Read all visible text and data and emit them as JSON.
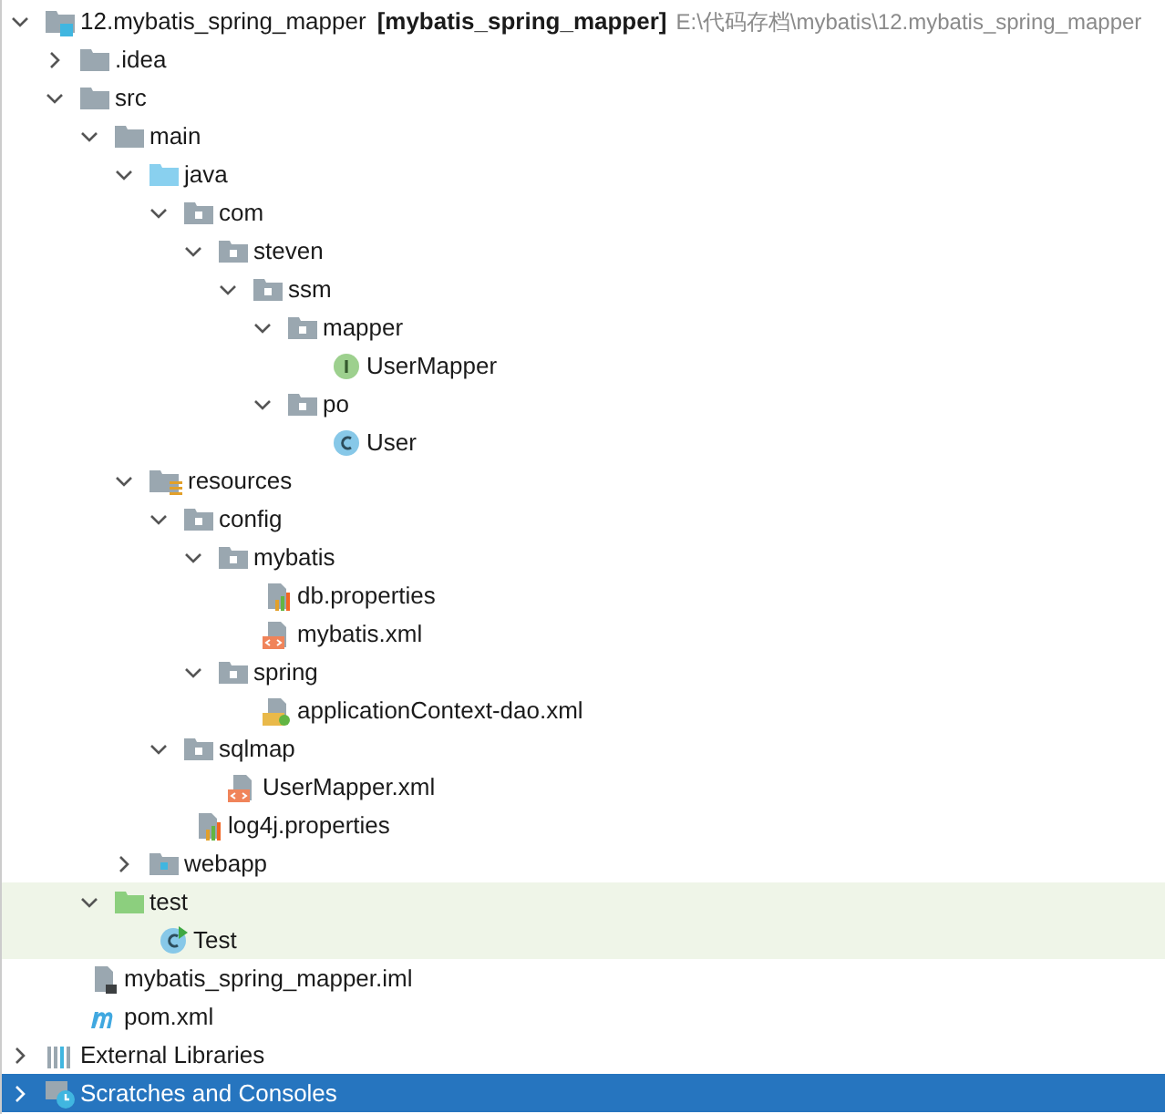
{
  "tree": [
    {
      "label": "12.mybatis_spring_mapper",
      "module": "[mybatis_spring_mapper]",
      "path": "E:\\代码存档\\mybatis\\12.mybatis_spring_mapper",
      "kind": "project",
      "expanded": true,
      "selected": false,
      "highlighted": false,
      "children": [
        {
          "label": ".idea",
          "kind": "folder",
          "expanded": false,
          "selected": false,
          "highlighted": false
        },
        {
          "label": "src",
          "kind": "folder",
          "expanded": true,
          "selected": false,
          "highlighted": false,
          "children": [
            {
              "label": "main",
              "kind": "folder",
              "expanded": true,
              "selected": false,
              "highlighted": false,
              "children": [
                {
                  "label": "java",
                  "kind": "source",
                  "expanded": true,
                  "selected": false,
                  "highlighted": false,
                  "children": [
                    {
                      "label": "com",
                      "kind": "package",
                      "expanded": true,
                      "selected": false,
                      "highlighted": false,
                      "children": [
                        {
                          "label": "steven",
                          "kind": "package",
                          "expanded": true,
                          "selected": false,
                          "highlighted": false,
                          "children": [
                            {
                              "label": "ssm",
                              "kind": "package",
                              "expanded": true,
                              "selected": false,
                              "highlighted": false,
                              "children": [
                                {
                                  "label": "mapper",
                                  "kind": "package",
                                  "expanded": true,
                                  "selected": false,
                                  "highlighted": false,
                                  "children": [
                                    {
                                      "label": "UserMapper",
                                      "kind": "interface",
                                      "selected": false,
                                      "highlighted": false
                                    }
                                  ]
                                },
                                {
                                  "label": "po",
                                  "kind": "package",
                                  "expanded": true,
                                  "selected": false,
                                  "highlighted": false,
                                  "children": [
                                    {
                                      "label": "User",
                                      "kind": "class",
                                      "selected": false,
                                      "highlighted": false
                                    }
                                  ]
                                }
                              ]
                            }
                          ]
                        }
                      ]
                    }
                  ]
                },
                {
                  "label": "resources",
                  "kind": "resources",
                  "expanded": true,
                  "selected": false,
                  "highlighted": false,
                  "children": [
                    {
                      "label": "config",
                      "kind": "package",
                      "expanded": true,
                      "selected": false,
                      "highlighted": false,
                      "children": [
                        {
                          "label": "mybatis",
                          "kind": "package",
                          "expanded": true,
                          "selected": false,
                          "highlighted": false,
                          "children": [
                            {
                              "label": "db.properties",
                              "kind": "properties",
                              "selected": false,
                              "highlighted": false
                            },
                            {
                              "label": "mybatis.xml",
                              "kind": "xml",
                              "selected": false,
                              "highlighted": false
                            }
                          ]
                        },
                        {
                          "label": "spring",
                          "kind": "package",
                          "expanded": true,
                          "selected": false,
                          "highlighted": false,
                          "children": [
                            {
                              "label": "applicationContext-dao.xml",
                              "kind": "spring-xml",
                              "selected": false,
                              "highlighted": false
                            }
                          ]
                        }
                      ]
                    },
                    {
                      "label": "sqlmap",
                      "kind": "package",
                      "expanded": true,
                      "selected": false,
                      "highlighted": false,
                      "children": [
                        {
                          "label": "UserMapper.xml",
                          "kind": "xml",
                          "selected": false,
                          "highlighted": false
                        }
                      ]
                    },
                    {
                      "label": "log4j.properties",
                      "kind": "properties",
                      "selected": false,
                      "highlighted": false
                    }
                  ]
                },
                {
                  "label": "webapp",
                  "kind": "web",
                  "expanded": false,
                  "selected": false,
                  "highlighted": false
                }
              ]
            },
            {
              "label": "test",
              "kind": "test",
              "expanded": true,
              "selected": false,
              "highlighted": true,
              "children": [
                {
                  "label": "Test",
                  "kind": "test-class",
                  "selected": false,
                  "highlighted": true
                }
              ]
            }
          ]
        },
        {
          "label": "mybatis_spring_mapper.iml",
          "kind": "iml",
          "selected": false,
          "highlighted": false
        },
        {
          "label": "pom.xml",
          "kind": "maven",
          "selected": false,
          "highlighted": false
        }
      ]
    },
    {
      "label": "External Libraries",
      "kind": "libraries",
      "expanded": false,
      "selected": false,
      "highlighted": false
    },
    {
      "label": "Scratches and Consoles",
      "kind": "scratches",
      "expanded": false,
      "selected": true,
      "highlighted": false
    }
  ]
}
